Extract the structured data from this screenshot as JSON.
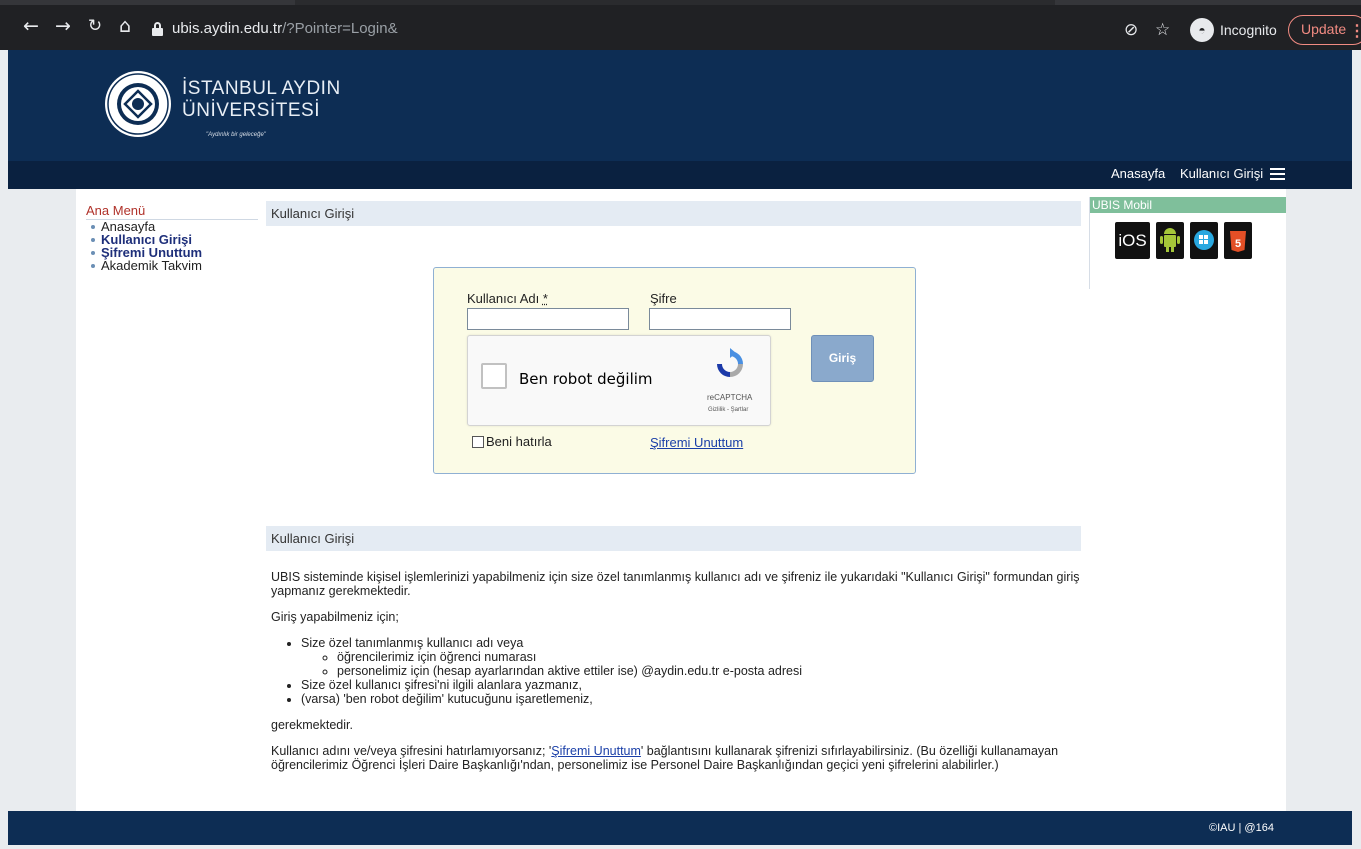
{
  "browser": {
    "url_host": "ubis.aydin.edu.tr",
    "url_path": "/?Pointer=Login&",
    "incognito_label": "Incognito",
    "update_label": "Update"
  },
  "header": {
    "name_line1": "İSTANBUL AYDIN",
    "name_line2": "ÜNİVERSİTESİ",
    "slogan": "\"Aydınlık bir geleceğe\""
  },
  "topnav": {
    "home": "Anasayfa",
    "login": "Kullanıcı Girişi"
  },
  "left_menu": {
    "title": "Ana Menü",
    "items": [
      {
        "label": "Anasayfa"
      },
      {
        "label": "Kullanıcı Girişi"
      },
      {
        "label": "Şifremi Unuttum"
      },
      {
        "label": "Akademik Takvim"
      }
    ]
  },
  "login": {
    "section_title": "Kullanıcı Girişi",
    "username_label": "Kullanıcı Adı",
    "required_mark": "*",
    "password_label": "Şifre",
    "captcha_text": "Ben robot değilim",
    "captcha_brand": "reCAPTCHA",
    "captcha_terms": "Gizlilik - Şartlar",
    "submit_label": "Giriş",
    "remember_label": "Beni hatırla",
    "forgot_label": "Şifremi Unuttum"
  },
  "info": {
    "section_title": "Kullanıcı Girişi",
    "intro": "UBIS sisteminde kişisel işlemlerinizi yapabilmeniz için size özel tanımlanmış kullanıcı adı ve şifreniz ile yukarıdaki \"Kullanıcı Girişi\" formundan giriş yapmanız gerekmektedir.",
    "lead": "Giriş yapabilmeniz için;",
    "bullet1": "Size özel tanımlanmış kullanıcı adı veya",
    "sub1": "öğrencilerimiz için öğrenci numarası",
    "sub2": "personelimiz için (hesap ayarlarından aktive ettiler ise) @aydin.edu.tr e-posta adresi",
    "bullet2": "Size özel kullanıcı şifresi'ni ilgili alanlara yazmanız,",
    "bullet3": "(varsa) 'ben robot değilim' kutucuğunu işaretlemeniz,",
    "closing": "gerekmektedir.",
    "forgot_pre": "Kullanıcı adını ve/veya şifresini hatırlamıyorsanız; '",
    "forgot_link": "Şifremi Unuttum",
    "forgot_post": "' bağlantısını kullanarak şifrenizi sıfırlayabilirsiniz. (Bu özelliği kullanamayan öğrencilerimiz Öğrenci İşleri Daire Başkanlığı'ndan, personelimiz ise Personel Daire Başkanlığından geçici yeni şifrelerini alabilirler.)"
  },
  "right_panel": {
    "title": "UBIS Mobil",
    "apps": [
      "iOS",
      "android-icon",
      "windows-icon",
      "html5-icon"
    ]
  },
  "footer": {
    "copyright": "©IAU | @164"
  },
  "colors": {
    "header_bg": "#0d2d54",
    "nav_bg": "#0a2140",
    "accent_green": "#7fbf9b",
    "menu_title": "#b0322a"
  }
}
